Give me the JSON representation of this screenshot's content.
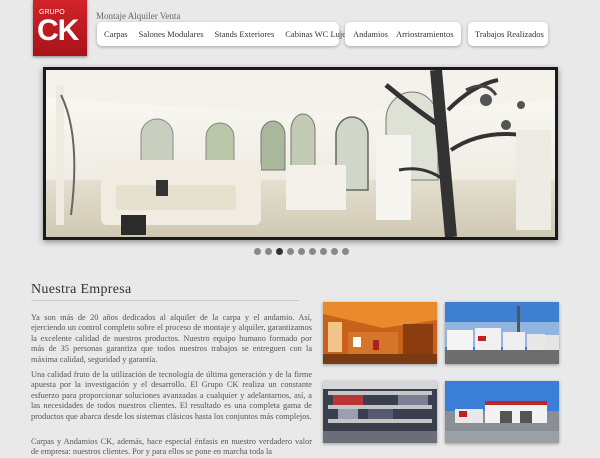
{
  "logo": {
    "small": "GRUPO",
    "big": "CK"
  },
  "tagline": "Montaje Alquiler Venta",
  "nav": {
    "group1": [
      "Carpas",
      "Salones Modulares",
      "Stands Exteriores",
      "Cabinas WC Lujo"
    ],
    "group2": [
      "Andamios",
      "Arriostramientos"
    ],
    "group3": [
      "Trabajos Realizados"
    ]
  },
  "slider": {
    "dots": 9,
    "active_index": 2
  },
  "content": {
    "title": "Nuestra Empresa",
    "paragraphs": [
      "Ya son más de 20 años dedicados al alquiler de la carpa y el andamio. Así, ejerciendo un control completo sobre el proceso de montaje y alquiler, garantizamos la excelente calidad de nuestros productos. Nuestro equipo humano formado por más de 35 personas garantiza que todos nuestros trabajos se entreguen con la máxima calidad, seguridad y garantía.",
      "Una calidad fruto de la utilización de tecnología de última generación y de la firme apuesta por la investigación y el desarrollo. El Grupo CK realiza un constante esfuerzo para proporcionar soluciones avanzadas a cualquier y adelantarnos, así, a las necesidades de todos nuestros clientes. El resultado es una completa gama de productos que abarca desde los sistemas clásicos hasta los conjuntos más complejos.",
      "Carpas y Andamios CK, además, hace especial énfasis en nuestro verdadero valor de empresa: nuestros clientes. Por y para ellos se pone en marcha toda la"
    ]
  }
}
